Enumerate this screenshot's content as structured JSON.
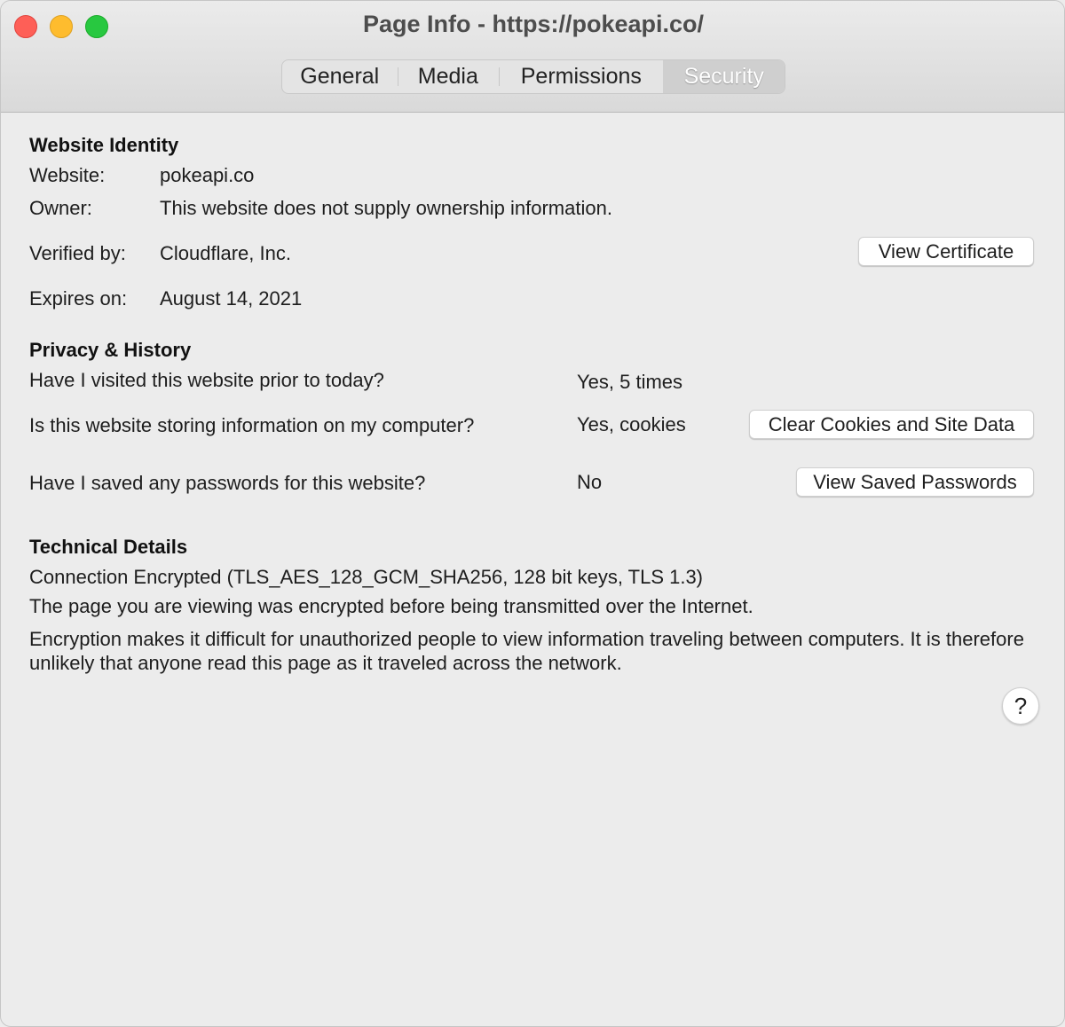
{
  "window": {
    "title": "Page Info - https://pokeapi.co/",
    "controls": [
      "close",
      "minimize",
      "zoom"
    ]
  },
  "tabs": [
    {
      "label": "General",
      "selected": false
    },
    {
      "label": "Media",
      "selected": false
    },
    {
      "label": "Permissions",
      "selected": false
    },
    {
      "label": "Security",
      "selected": true
    }
  ],
  "identity": {
    "heading": "Website Identity",
    "website_label": "Website:",
    "website_value": "pokeapi.co",
    "owner_label": "Owner:",
    "owner_value": "This website does not supply ownership information.",
    "verified_label": "Verified by:",
    "verified_value": "Cloudflare, Inc.",
    "view_certificate": "View Certificate",
    "expires_label": "Expires on:",
    "expires_value": "August 14, 2021"
  },
  "privacy": {
    "heading": "Privacy & History",
    "visited_q": "Have I visited this website prior to today?",
    "visited_a": "Yes, 5 times",
    "storing_q": "Is this website storing information on my computer?",
    "storing_a": "Yes, cookies",
    "clear_button": "Clear Cookies and Site Data",
    "passwords_q": "Have I saved any passwords for this website?",
    "passwords_a": "No",
    "passwords_button": "View Saved Passwords"
  },
  "technical": {
    "heading": "Technical Details",
    "connection": "Connection Encrypted (TLS_AES_128_GCM_SHA256, 128 bit keys, TLS 1.3)",
    "encrypted_note": "The page you are viewing was encrypted before being transmitted over the Internet.",
    "explanation": "Encryption makes it difficult for unauthorized people to view information traveling between computers. It is therefore unlikely that anyone read this page as it traveled across the network."
  },
  "help": {
    "label": "?"
  }
}
